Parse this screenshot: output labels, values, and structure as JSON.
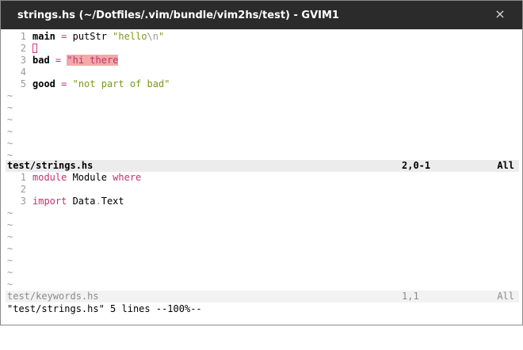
{
  "window": {
    "title": "strings.hs (~/Dotfiles/.vim/bundle/vim2hs/test) - GVIM1",
    "close_icon": "×"
  },
  "top_buffer": {
    "lines": [
      {
        "num": "1",
        "t1": "main",
        "t2": " = ",
        "t3": "putStr ",
        "t4": "\"hello",
        "t5": "\\n",
        "t6": "\""
      },
      {
        "num": "2"
      },
      {
        "num": "3",
        "t1": "bad",
        "t2": " = ",
        "t3": "\"hi there"
      },
      {
        "num": "4"
      },
      {
        "num": "5",
        "t1": "good",
        "t2": " = ",
        "t3": "\"not part of bad\""
      }
    ],
    "tilde": "~"
  },
  "top_status": {
    "name": "test/strings.hs",
    "pos": "2,0-1",
    "scroll": "All"
  },
  "bottom_buffer": {
    "lines": [
      {
        "num": "1",
        "t1": "module",
        "t2": " Module ",
        "t3": "where"
      },
      {
        "num": "2"
      },
      {
        "num": "3",
        "t1": "import",
        "t2": " Data",
        "t3": ".",
        "t4": "Text"
      }
    ],
    "tilde": "~"
  },
  "bottom_status": {
    "name": "test/keywords.hs",
    "pos": "1,1",
    "scroll": "All"
  },
  "command_line": {
    "text": "\"test/strings.hs\" 5 lines --100%--"
  },
  "colors": {
    "titlebar": "#2b2b2b",
    "keyword": "#c0336f",
    "string": "#7a9a18",
    "error_bg": "#f3a9a8"
  }
}
